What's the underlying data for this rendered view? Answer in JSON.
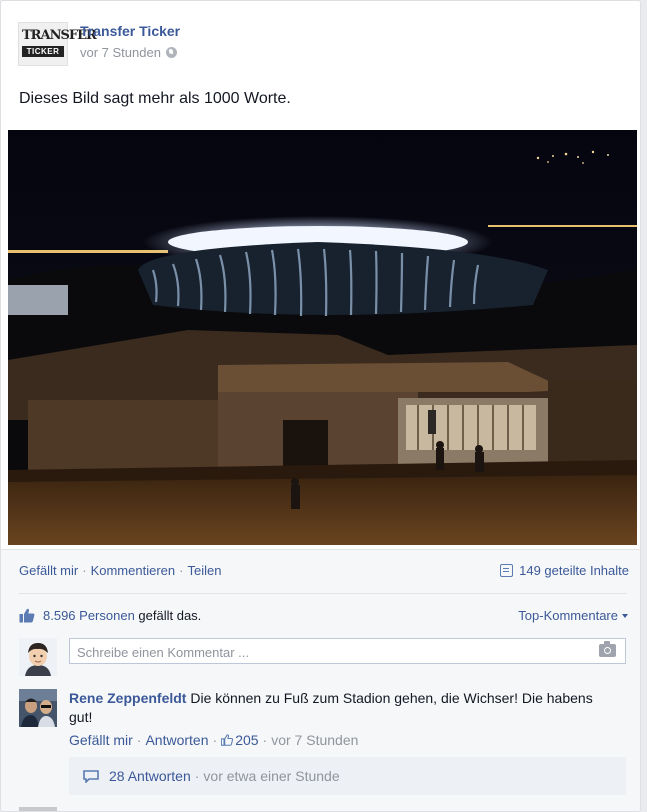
{
  "post": {
    "page_name": "Transfer Ticker",
    "logo_top": "TRANSFER",
    "logo_bottom": "TICKER",
    "time": "vor 7 Stunden",
    "text": "Dieses Bild sagt mehr als 1000 Worte."
  },
  "actions": {
    "like": "Gefällt mir",
    "comment": "Kommentieren",
    "share": "Teilen",
    "shared": "149 geteilte Inhalte"
  },
  "likes": {
    "count_people": "8.596 Personen",
    "suffix": " gefällt das.",
    "sort": "Top-Kommentare"
  },
  "comment_input": {
    "placeholder": "Schreibe einen Kommentar ..."
  },
  "comment": {
    "author": "Rene Zeppenfeldt",
    "text": "Die können zu Fuß zum Stadion gehen, die Wichser! Die habens gut!",
    "like": "Gefällt mir",
    "reply": "Antworten",
    "likes": "205",
    "time": "vor 7 Stunden",
    "replies": "28 Antworten",
    "replies_time": "vor etwa einer Stunde"
  },
  "colors": {
    "link": "#3b5998",
    "meta": "#90949c",
    "panel": "#f6f7f9"
  }
}
